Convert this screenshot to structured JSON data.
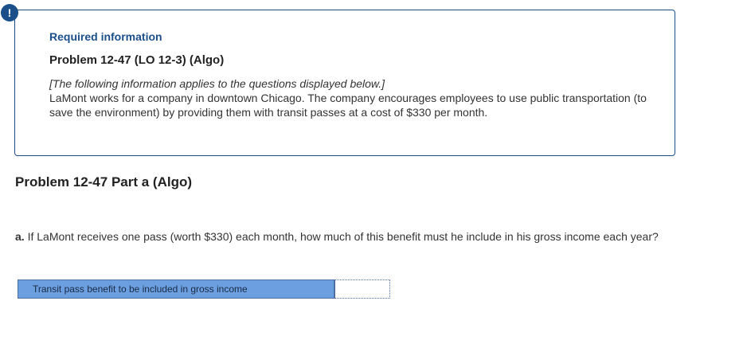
{
  "alert": {
    "icon": "exclamation-icon",
    "glyph": "!",
    "color": "#1b4f8a"
  },
  "info": {
    "heading": "Required information",
    "problem_title": "Problem 12-47 (LO 12-3) (Algo)",
    "note": "[The following information applies to the questions displayed below.]",
    "body": "LaMont works for a company in downtown Chicago. The company encourages employees to use public transportation (to save the environment) by providing them with transit passes at a cost of $330 per month."
  },
  "part": {
    "title": "Problem 12-47 Part a (Algo)"
  },
  "question": {
    "letter": "a.",
    "text": "If LaMont receives one pass (worth $330) each month, how much of this benefit must he include in his gross income each year?"
  },
  "answer": {
    "label": "Transit pass benefit to be included in gross income",
    "value": "",
    "label_bg": "#6c9fe0"
  }
}
